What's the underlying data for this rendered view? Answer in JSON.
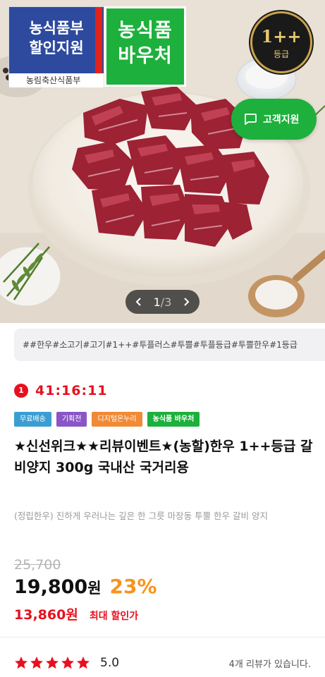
{
  "hero": {
    "ministry_badge": {
      "line1": "농식품부",
      "line2": "할인지원",
      "footer": "농림축산식품부"
    },
    "voucher_badge": {
      "line1": "농식품",
      "line2": "바우처"
    },
    "grade_badge": {
      "grade": "1++",
      "label": "등급"
    },
    "support_button": {
      "label": "고객지원",
      "icon": "chat-bubble-icon"
    },
    "pager": {
      "prev_icon": "chevron-left-icon",
      "current": "1",
      "total": "/3",
      "next_icon": "chevron-right-icon"
    }
  },
  "tags": {
    "text": "##한우#소고기#고기#1++#투플러스#투쁠#투플등급#투쁠한우#1등급"
  },
  "timer": {
    "icon_label": "1",
    "time": "41:16:11",
    "color": "#e8101e"
  },
  "chips": [
    {
      "label": "무료배송",
      "color": "#3b9ed2"
    },
    {
      "label": "기획전",
      "color": "#8a56c5"
    },
    {
      "label": "디지털온누리",
      "color": "#f08a36"
    },
    {
      "label": "농식품 바우처",
      "color": "#1db03c"
    }
  ],
  "product": {
    "title": "★신선위크★★리뷰이벤트★(농할)한우 1++등급 갈비양지 300g 국내산 국거리용",
    "description": "(정립한우) 진하게 우러나는 깊은 한 그릇 마장동 투뿔 한우 갈비 양지"
  },
  "price": {
    "original": "25,700",
    "sale": "19,800",
    "currency": "원",
    "discount_rate": "23%",
    "max_discount_price": "13,860원",
    "max_discount_label": "최대 할인가"
  },
  "rating": {
    "stars": 5,
    "score": "5.0",
    "review_count_text": "4개 리뷰가 있습니다.",
    "star_color": "#e8101e"
  },
  "colors": {
    "brand_green": "#1db03c",
    "accent_red": "#e8101e",
    "discount_orange": "#f7941d"
  }
}
